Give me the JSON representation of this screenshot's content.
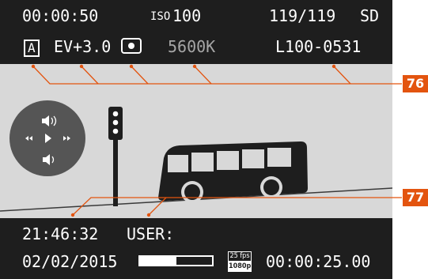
{
  "top": {
    "rec_time": "00:00:50",
    "iso_label": "ISO",
    "iso_value": "100",
    "counter": "119/119",
    "card": "SD",
    "mode": "A",
    "ev": "EV+3.0",
    "metering_icon": "spot-metering-icon",
    "white_balance": "5600K",
    "file_name": "L100-0531"
  },
  "bottom": {
    "clock": "21:46:32",
    "user": "USER:",
    "date": "02/02/2015",
    "progress": 0.5,
    "fps": "25 fps",
    "resolution": "1080p",
    "elapsed": "00:00:25.00"
  },
  "controls": {
    "icons": [
      "volume-up-icon",
      "rewind-icon",
      "play-icon",
      "fast-forward-icon",
      "volume-down-icon"
    ]
  },
  "callouts": [
    "76",
    "77"
  ],
  "colors": {
    "callout": "#e3540f",
    "bars": "#1e1e1e",
    "screen": "#d8d8d8"
  }
}
